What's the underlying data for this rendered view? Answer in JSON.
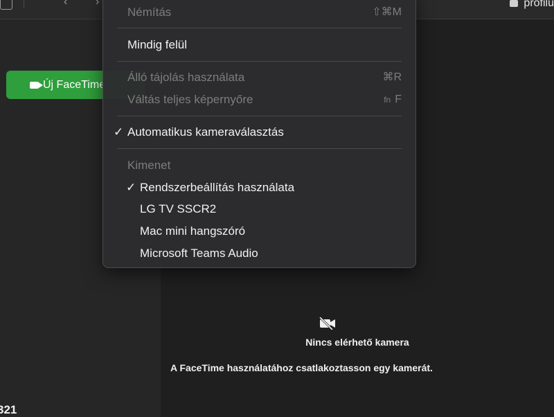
{
  "titlebar": {
    "back_icon": "‹",
    "forward_icon": "›",
    "profile_label": "profilu"
  },
  "sidebar": {
    "new_facetime_label": "Új FaceTime",
    "footer_text": "321"
  },
  "main": {
    "nocam_title": "Nincs elérhető kamera",
    "nocam_subtitle": "A FaceTime használatához csatlakoztasson egy kamerát."
  },
  "menu": {
    "mute_label": "Némítás",
    "mute_shortcut": "⇧⌘M",
    "always_on_top_label": "Mindig felül",
    "portrait_label": "Álló tájolás használata",
    "portrait_shortcut": "⌘R",
    "fullscreen_label": "Váltás teljes képernyőre",
    "fullscreen_shortcut_fn": "fn",
    "fullscreen_shortcut_key": "F",
    "auto_camera_label": "Automatikus kameraválasztás",
    "auto_camera_checked": "✓",
    "output_header": "Kimenet",
    "output_items": [
      {
        "label": "Rendszerbeállítás használata",
        "check": "✓"
      },
      {
        "label": "LG TV SSCR2",
        "check": ""
      },
      {
        "label": "Mac mini hangszóró",
        "check": ""
      },
      {
        "label": "Microsoft Teams Audio",
        "check": ""
      }
    ]
  },
  "colors": {
    "accent_green": "#2f9e3c",
    "menu_bg": "#2c2c2e",
    "disabled_text": "#7d7d7d"
  }
}
